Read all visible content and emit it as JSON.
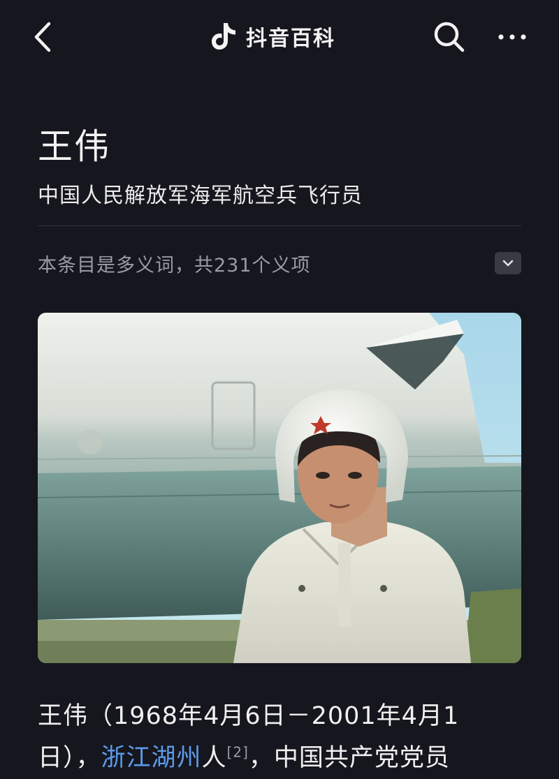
{
  "header": {
    "brand_name": "抖音百科",
    "back_icon": "chevron-left-icon",
    "search_icon": "search-icon",
    "more_icon": "more-horizontal-icon"
  },
  "entry": {
    "title": "王伟",
    "subtitle": "中国人民解放军海军航空兵飞行员",
    "polysemy_note": "本条目是多义词，共231个义项"
  },
  "intro": {
    "part1": "王伟（1968年4月6日－2001年4月1日），",
    "link_text": "浙江湖州",
    "part2": "人",
    "citation": "[2]",
    "part3": "，中国共产党党员"
  },
  "colors": {
    "background": "#16161e",
    "link": "#5b9bea"
  }
}
